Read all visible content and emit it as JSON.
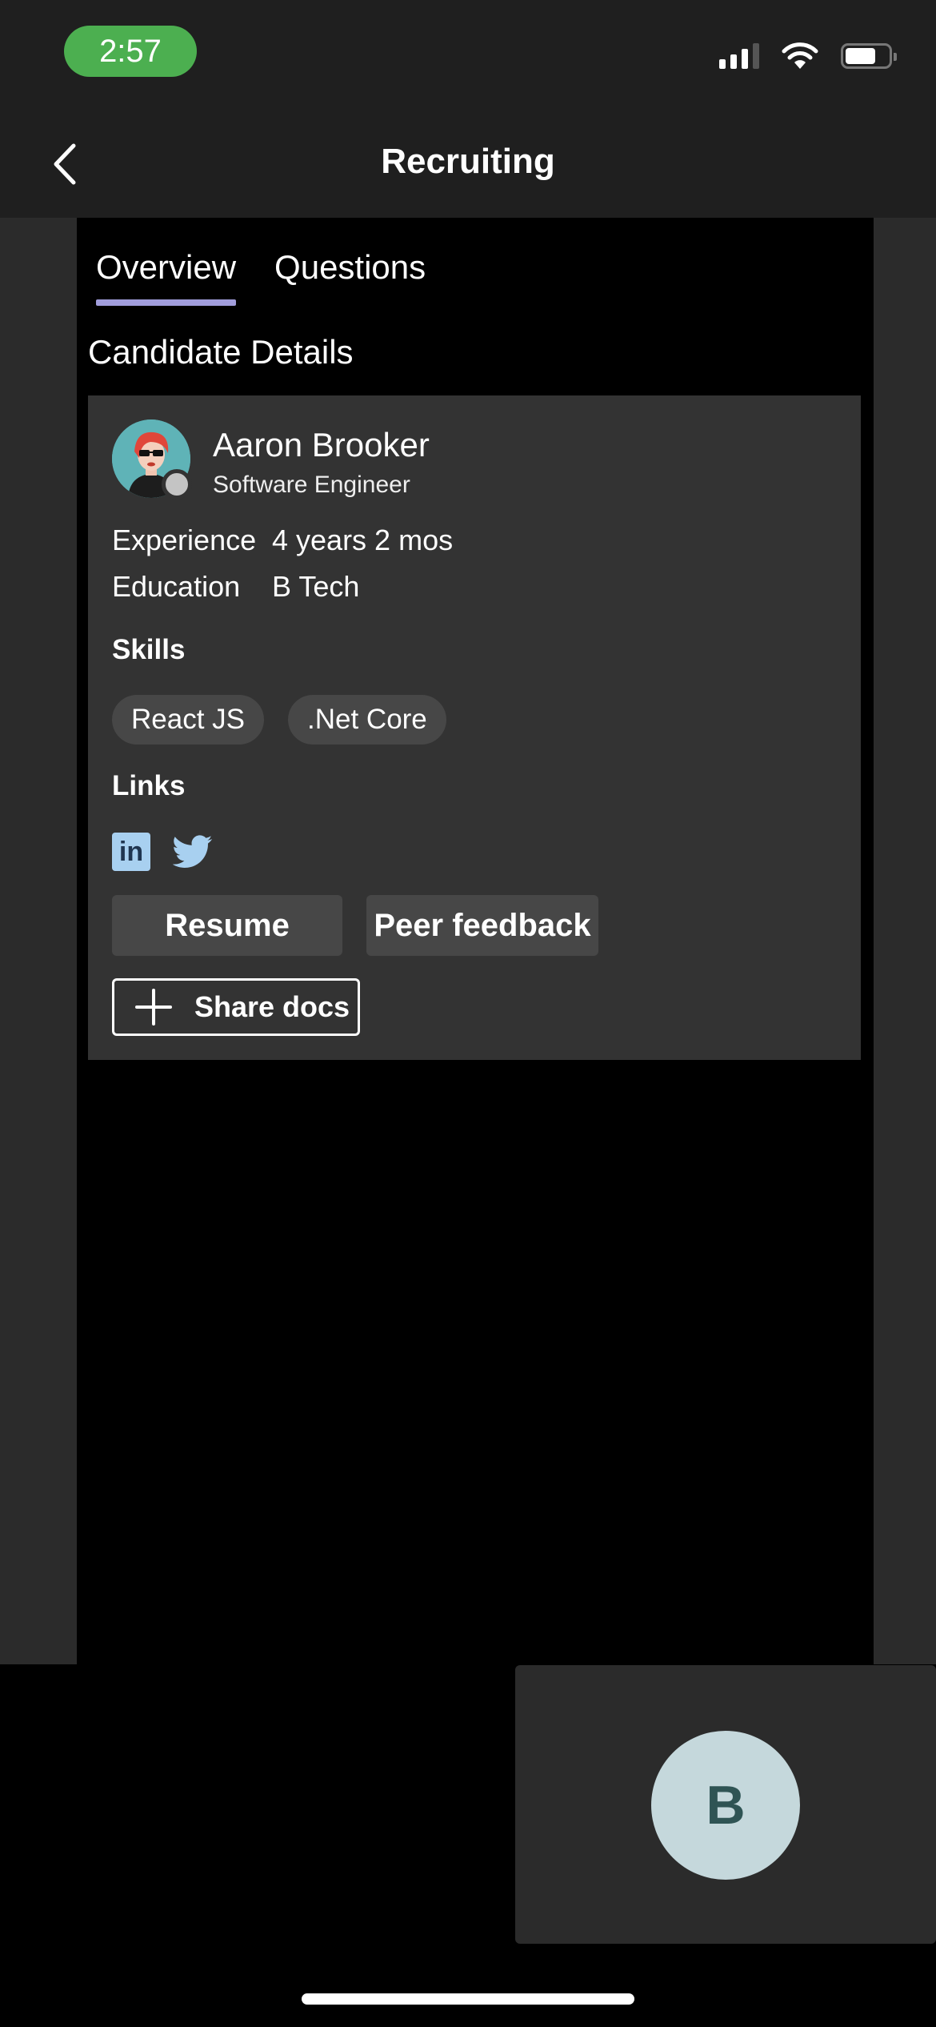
{
  "status_bar": {
    "time": "2:57",
    "icons": [
      "signal-icon",
      "wifi-icon",
      "battery-icon"
    ]
  },
  "header": {
    "title": "Recruiting",
    "back_icon": "chevron-left-icon"
  },
  "tabs": [
    {
      "label": "Overview",
      "active": true
    },
    {
      "label": "Questions",
      "active": false
    }
  ],
  "section_title": "Candidate Details",
  "candidate": {
    "name": "Aaron Brooker",
    "role": "Software Engineer",
    "details": [
      {
        "label": "Experience",
        "value": "4 years 2 mos"
      },
      {
        "label": "Education",
        "value": "B Tech"
      }
    ],
    "skills_heading": "Skills",
    "skills": [
      "React JS",
      ".Net Core"
    ],
    "links_heading": "Links",
    "links": [
      {
        "icon": "linkedin-icon",
        "text": "in"
      },
      {
        "icon": "twitter-icon"
      }
    ],
    "buttons": {
      "resume": "Resume",
      "peer_feedback": "Peer feedback",
      "share_docs": "Share docs"
    }
  },
  "call_preview": {
    "initial": "B"
  },
  "colors": {
    "accent_underline": "#a19ddb",
    "time_pill": "#4caf50",
    "card_bg": "#333333",
    "chip_bg": "#474747"
  }
}
